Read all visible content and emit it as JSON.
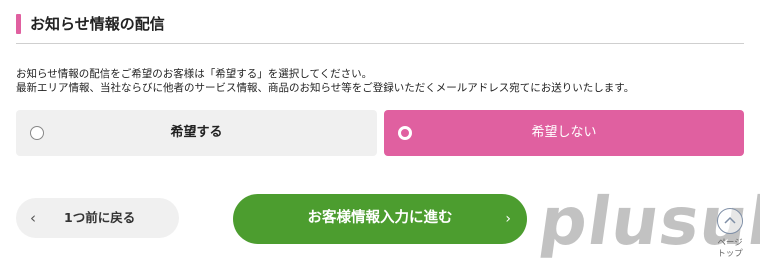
{
  "section": {
    "title": "お知らせ情報の配信"
  },
  "description": {
    "line1": "お知らせ情報の配信をご希望のお客様は「希望する」を選択してください。",
    "line2": "最新エリア情報、当社ならびに他者のサービス情報、商品のお知らせ等をご登録いただくメールアドレス宛てにお送りいたします。"
  },
  "options": [
    {
      "label": "希望する",
      "selected": false
    },
    {
      "label": "希望しない",
      "selected": true
    }
  ],
  "buttons": {
    "back_label": "1つ前に戻る",
    "back_icon": "‹",
    "next_label": "お客様情報入力に進む",
    "next_icon": "›"
  },
  "page_top": {
    "line1": "ページ",
    "line2": "トップ"
  },
  "watermark": "plusul",
  "colors": {
    "accent_pink": "#e060a0",
    "primary_green": "#4c9d2f",
    "option_bg": "#f0f0f0"
  }
}
